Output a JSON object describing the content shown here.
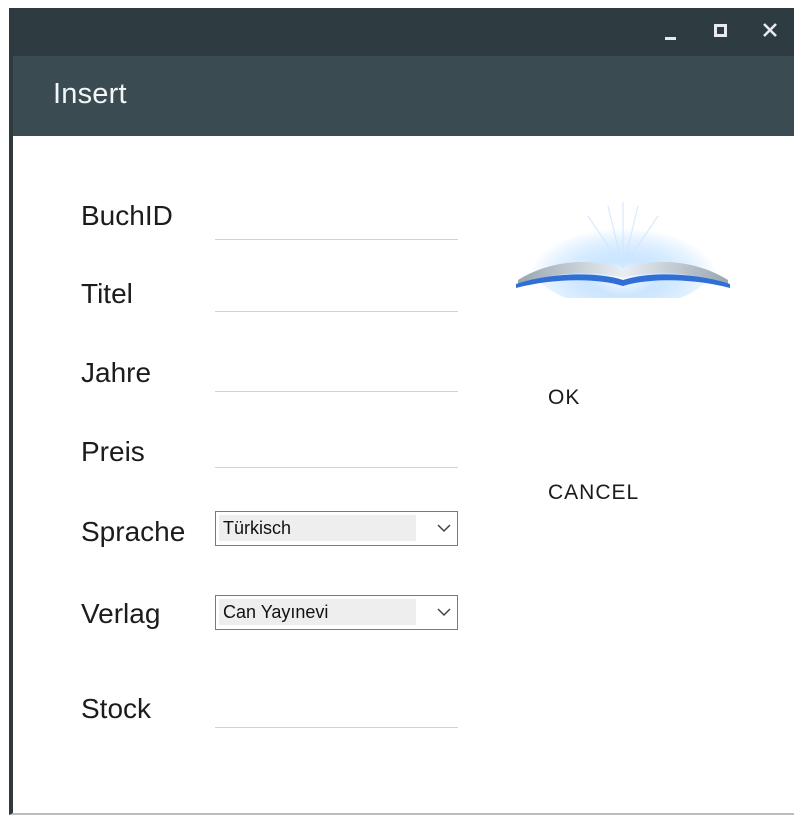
{
  "window": {
    "title": "Insert",
    "controls": {
      "minimize_icon": "minimize-icon",
      "maximize_icon": "maximize-icon",
      "close_icon": "close-icon"
    }
  },
  "form": {
    "buchid": {
      "label": "BuchID",
      "value": ""
    },
    "titel": {
      "label": "Titel",
      "value": ""
    },
    "jahre": {
      "label": "Jahre",
      "value": ""
    },
    "preis": {
      "label": "Preis",
      "value": ""
    },
    "sprache": {
      "label": "Sprache",
      "selected": "Türkisch"
    },
    "verlag": {
      "label": "Verlag",
      "selected": "Can Yayınevi"
    },
    "stock": {
      "label": "Stock",
      "value": ""
    }
  },
  "actions": {
    "ok_label": "OK",
    "cancel_label": "CANCEL"
  },
  "image": {
    "icon": "open-book-icon"
  },
  "colors": {
    "titlebar": "#2e3b41",
    "headerbar": "#3b4b52",
    "header_text": "#f3f6f7",
    "underline": "#cfd3d6"
  }
}
